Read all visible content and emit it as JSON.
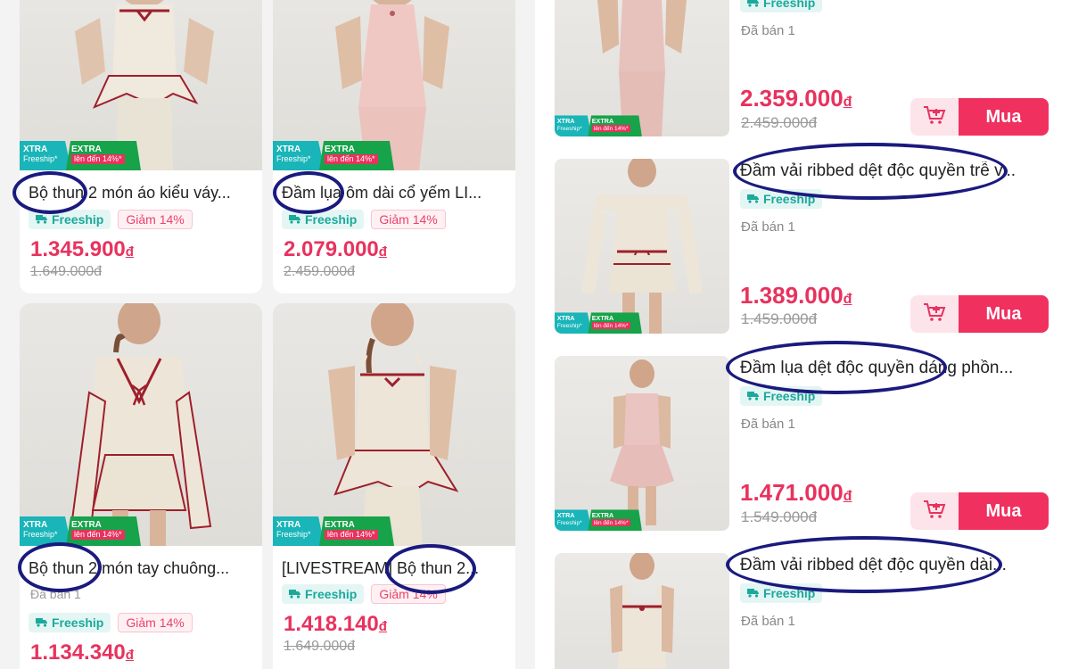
{
  "colors": {
    "accent": "#e8325e",
    "freeship": "#1ba99c",
    "annotation": "#1a1a7e"
  },
  "xtra_badge": {
    "label": "XTRA",
    "sub": "Freeship*",
    "extra": "EXTRA",
    "extra_sub": "lên đến 14%*"
  },
  "icons": {
    "freeship": "truck-icon",
    "cart": "cart-plus-icon"
  },
  "grid": {
    "products": [
      {
        "title": "Bộ thun 2 món áo kiểu váy...",
        "freeship": "Freeship",
        "discount": "Giảm 14%",
        "price": "1.345.900",
        "currency": "đ",
        "old_price": "1.649.000đ"
      },
      {
        "title": "Đầm lụa ôm dài cổ yếm  LI...",
        "freeship": "Freeship",
        "discount": "Giảm 14%",
        "price": "2.079.000",
        "currency": "đ",
        "old_price": "2.459.000đ"
      },
      {
        "title": "Bộ thun 2 món tay chuông...",
        "sold": "Đã bán 1",
        "freeship": "Freeship",
        "discount": "Giảm 14%",
        "price": "1.134.340",
        "currency": "đ"
      },
      {
        "title": "[LIVESTREAM] Bộ thun 2...",
        "freeship": "Freeship",
        "discount": "Giảm 14%",
        "price": "1.418.140",
        "currency": "đ",
        "old_price": "1.649.000đ"
      }
    ]
  },
  "list": {
    "items": [
      {
        "freeship": "Freeship",
        "sold": "Đã bán 1",
        "price": "2.359.000",
        "currency": "đ",
        "old_price": "2.459.000đ",
        "buy_label": "Mua"
      },
      {
        "title": "Đầm vải ribbed dệt độc quyền trễ v...",
        "freeship": "Freeship",
        "sold": "Đã bán 1",
        "price": "1.389.000",
        "currency": "đ",
        "old_price": "1.459.000đ",
        "buy_label": "Mua"
      },
      {
        "title": "Đầm lụa dệt độc quyền dáng phồn...",
        "freeship": "Freeship",
        "sold": "Đã bán 1",
        "price": "1.471.000",
        "currency": "đ",
        "old_price": "1.549.000đ",
        "buy_label": "Mua"
      },
      {
        "title": "Đầm vải ribbed dệt độc quyền dài...",
        "freeship": "Freeship",
        "sold": "Đã bán 1"
      }
    ]
  }
}
